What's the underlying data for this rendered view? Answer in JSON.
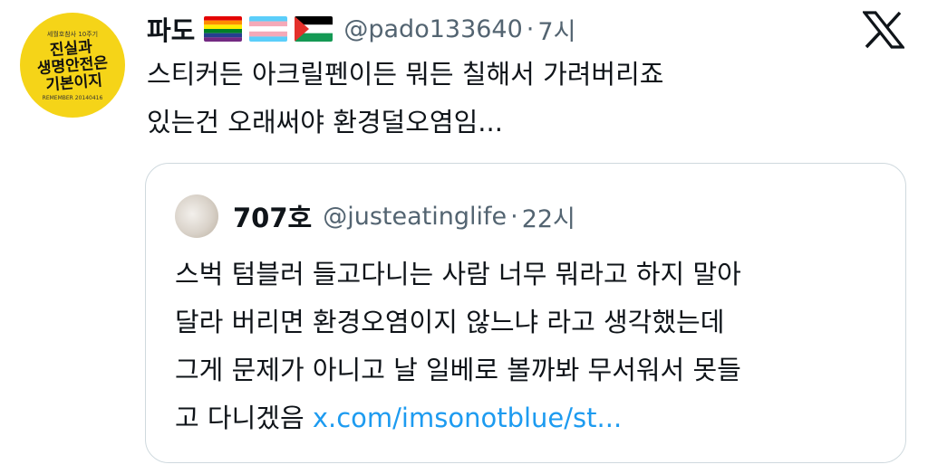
{
  "tweet": {
    "author_name": "파도",
    "flags": [
      "rainbow-flag",
      "transgender-flag",
      "palestine-flag"
    ],
    "handle": "@pado133640",
    "separator": "·",
    "time": "7시",
    "text_lines": [
      "스티커든 아크릴펜이든 뭐든 칠해서 가려버리죠",
      "있는건 오래써야 환경덜오염임..."
    ],
    "avatar": {
      "top_text": "세월호참사 10주기",
      "main_line1": "진실과",
      "main_line2": "생명안전은",
      "main_line3": "기본이지",
      "bottom_text": "REMEMBER 20140416"
    }
  },
  "x_logo_icon": "x-logo-icon",
  "quote": {
    "author_name": "707호",
    "handle": "@justeatinglife",
    "separator": "·",
    "time": "22시",
    "text_lines": [
      "스벅 텀블러 들고다니는 사람 너무 뭐라고 하지 말아",
      "달라 버리면 환경오염이지 않느냐 라고 생각했는데",
      "그게 문제가 아니고 날 일베로 볼까봐 무서워서 못들"
    ],
    "last_line_text": "고 다니겠음",
    "link": "x.com/imsonotblue/st..."
  },
  "colors": {
    "text": "#0f1419",
    "muted": "#536471",
    "link": "#1d9bf0",
    "border": "#cfd9de",
    "avatar_yellow": "#f5d418"
  }
}
